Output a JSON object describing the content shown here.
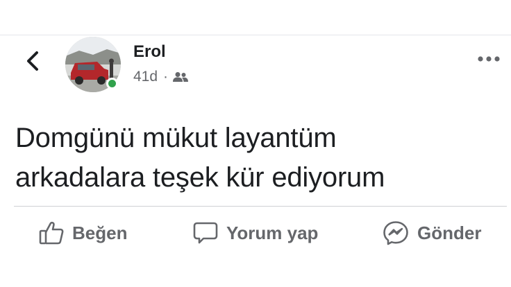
{
  "post": {
    "author": "Erol",
    "time": "41d",
    "separator": "·",
    "audience_icon": "friends-icon",
    "text_line1": "Domgünü mükut layantüm",
    "text_line2": "arkadalara teşek kür ediyorum",
    "online": true
  },
  "actions": {
    "like_label": "Beğen",
    "comment_label": "Yorum yap",
    "send_label": "Gönder"
  },
  "icons": {
    "back": "back-chevron-icon",
    "more": "more-horizontal-icon",
    "like": "thumbs-up-icon",
    "comment": "comment-bubble-icon",
    "send": "messenger-icon"
  },
  "colors": {
    "text": "#1c1e21",
    "secondary": "#65676b",
    "online": "#31a24c",
    "divider": "#ced0d4"
  }
}
